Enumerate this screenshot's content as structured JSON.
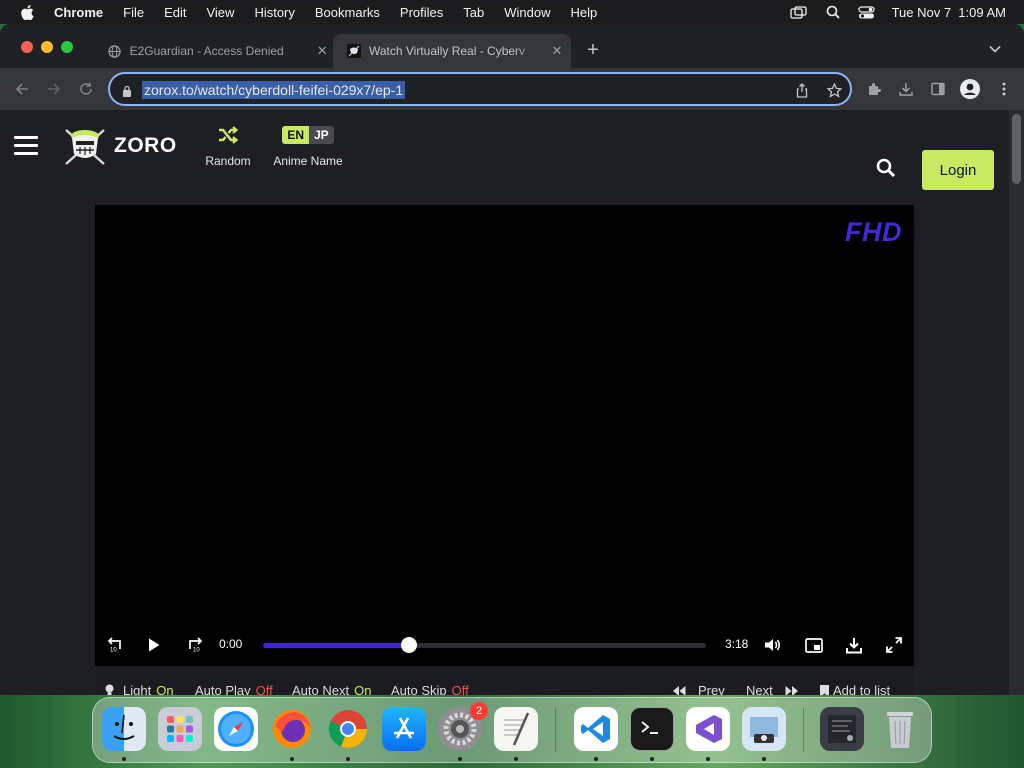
{
  "menubar": {
    "app_name": "Chrome",
    "items": [
      "File",
      "Edit",
      "View",
      "History",
      "Bookmarks",
      "Profiles",
      "Tab",
      "Window",
      "Help"
    ],
    "clock": "Tue Nov 7  1:09 AM"
  },
  "tabs": [
    {
      "title": "E2Guardian - Access Denied",
      "active": false
    },
    {
      "title": "Watch Virtually Real - Cyberv",
      "active": true
    }
  ],
  "address_bar": {
    "url": "zorox.to/watch/cyberdoll-feifei-029x7/ep-1",
    "selected": true
  },
  "site": {
    "logo_text": "ZORO",
    "random_label": "Random",
    "lang_en": "EN",
    "lang_jp": "JP",
    "anime_name_label": "Anime Name",
    "login_label": "Login",
    "accent_color": "#cae962"
  },
  "player": {
    "quality_badge": "FHD",
    "current_time": "0:00",
    "duration": "3:18",
    "progress_fraction": 0.33,
    "progress_color": "#3d22e0"
  },
  "player_options": {
    "light_label": "Light",
    "light_value": "On",
    "autoplay_label": "Auto Play",
    "autoplay_value": "Off",
    "autonext_label": "Auto Next",
    "autonext_value": "On",
    "autoskip_label": "Auto Skip",
    "autoskip_value": "Off",
    "prev_label": "Prev",
    "next_label": "Next",
    "add_to_list_label": "Add to list"
  },
  "dock": {
    "apps": [
      "finder",
      "launchpad",
      "safari",
      "firefox",
      "chrome",
      "app-store",
      "system-settings",
      "textedit",
      "vscode",
      "terminal",
      "visual-studio",
      "preview",
      "downloads",
      "trash"
    ],
    "system_settings_badge": "2"
  }
}
